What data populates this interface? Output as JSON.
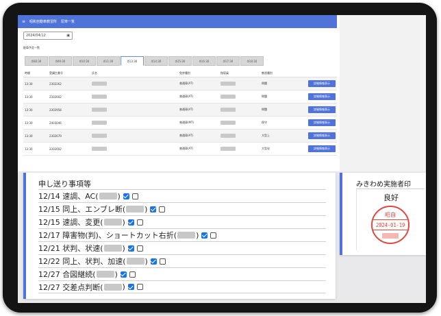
{
  "app": {
    "title": "昭和自動車教習所",
    "subtitle": "配車一覧"
  },
  "date_input": {
    "value": "2024/04/12",
    "icon": "calendar-icon"
  },
  "schedule_section_label": "配車予定一覧",
  "time_tabs": [
    {
      "label": "08:30",
      "active": false
    },
    {
      "label": "09:30",
      "active": false
    },
    {
      "label": "10:30",
      "active": false
    },
    {
      "label": "11:30",
      "active": false
    },
    {
      "label": "13:30",
      "active": true
    },
    {
      "label": "14:30",
      "active": false
    },
    {
      "label": "15:30",
      "active": false
    },
    {
      "label": "16:30",
      "active": false
    },
    {
      "label": "17:30",
      "active": false
    },
    {
      "label": "18:30",
      "active": false
    }
  ],
  "table": {
    "headers": [
      "時間",
      "受講生番号",
      "氏名",
      "免許種別",
      "指導員",
      "教習種別",
      ""
    ],
    "button_label": "詳細情報表示",
    "rows": [
      {
        "time": "13:30",
        "student_no": "2302262",
        "license": "普通車(AT)",
        "type": "問題"
      },
      {
        "time": "13:30",
        "student_no": "2302602",
        "license": "普通車(AT)",
        "type": "問題"
      },
      {
        "time": "13:30",
        "student_no": "2302958",
        "license": "普通車(AT)",
        "type": "問題"
      },
      {
        "time": "13:30",
        "student_no": "2403046",
        "license": "普通車(MT)",
        "type": "保守"
      },
      {
        "time": "13:30",
        "student_no": "2302679",
        "license": "普通車(AT)",
        "type": "大型上"
      },
      {
        "time": "13:30",
        "student_no": "2302602",
        "license": "普通車(AT)",
        "type": "大型化"
      }
    ]
  },
  "handover": {
    "title": "申し送り事項等",
    "rows": [
      {
        "before": "12/14 速調、AC(",
        "after": ")",
        "checked": true
      },
      {
        "before": "12/15 同上、エンブレ断(",
        "after": ")",
        "checked": true
      },
      {
        "before": "12/15 速調、変更(",
        "after": ")",
        "checked": true
      },
      {
        "before": "12/17 障害物(判)、ショートカット右折(",
        "after": ")",
        "checked": true
      },
      {
        "before": "12/21 状判、状速(",
        "after": ")",
        "checked": true
      },
      {
        "before": "12/22 同上、状判、加速(",
        "after": ")",
        "checked": true
      },
      {
        "before": "12/27 合図継続(",
        "after": ")",
        "checked": true
      },
      {
        "before": "12/27 交差点判断(",
        "after": ")",
        "checked": true
      }
    ]
  },
  "inspector": {
    "title": "みきわめ実施者印",
    "result": "良好",
    "stamp": {
      "name": "昭自",
      "date": "2024-01-19",
      "color": "#e0483e"
    }
  },
  "colors": {
    "accent": "#4f73d9",
    "checkbox": "#1a73e8"
  }
}
